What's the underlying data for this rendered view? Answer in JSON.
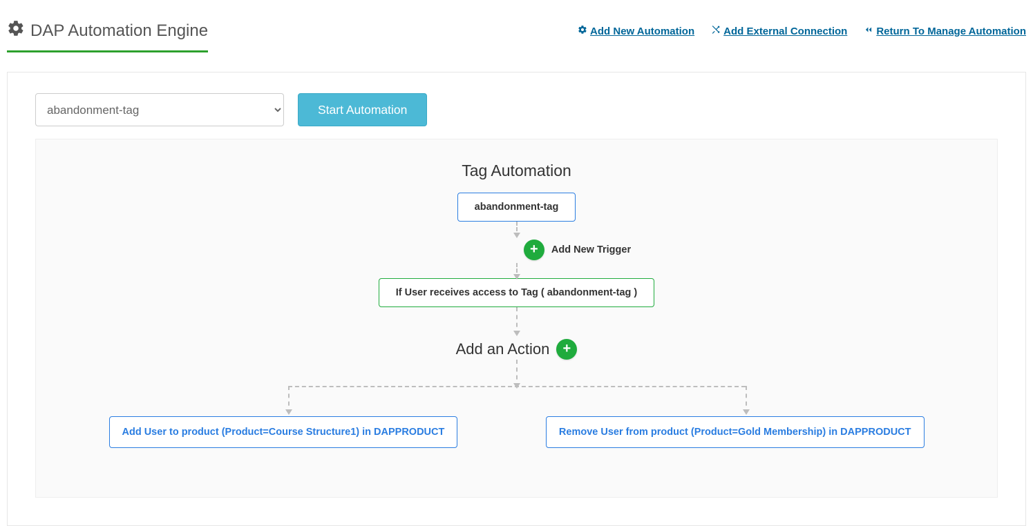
{
  "header": {
    "title": "DAP Automation Engine",
    "links": {
      "add_new": "Add New Automation",
      "add_connection": "Add External Connection",
      "return": "Return To Manage Automation"
    }
  },
  "toolbar": {
    "select_value": "abandonment-tag",
    "start_label": "Start Automation"
  },
  "canvas": {
    "title": "Tag Automation",
    "tag_name": "abandonment-tag",
    "add_trigger_label": "Add New Trigger",
    "trigger_text": "If User receives access to Tag ( abandonment-tag )",
    "add_action_label": "Add an Action",
    "actions": [
      "Add User to product (Product=Course Structure1) in DAPPRODUCT",
      "Remove User from product (Product=Gold Membership) in DAPPRODUCT"
    ]
  }
}
